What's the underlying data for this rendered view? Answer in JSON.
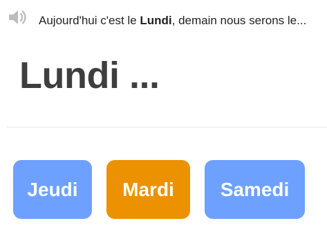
{
  "audio": {
    "icon": "speaker-icon"
  },
  "prompt": {
    "before": "Aujourd'hui c'est le ",
    "highlight": "Lundi",
    "after": ", demain nous serons le..."
  },
  "question": {
    "text": "Lundi ..."
  },
  "choices": [
    {
      "label": "Jeudi",
      "color": "#6ea1ff",
      "state": "default"
    },
    {
      "label": "Mardi",
      "color": "#ec9100",
      "state": "selected"
    },
    {
      "label": "Samedi",
      "color": "#6ea1ff",
      "state": "default"
    }
  ]
}
